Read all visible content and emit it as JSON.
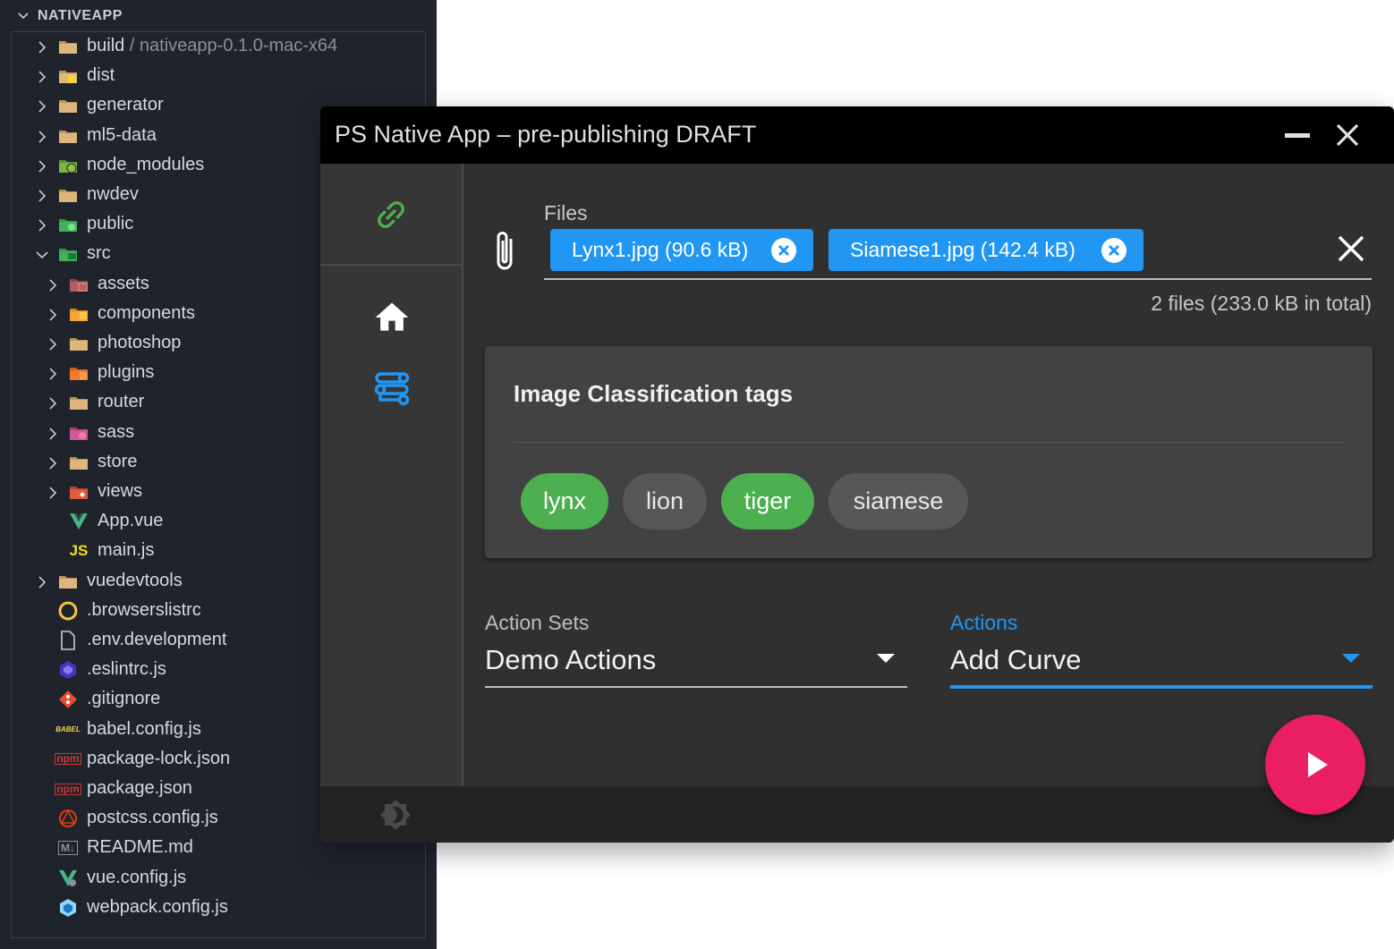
{
  "explorer": {
    "root_label": "NATIVEAPP",
    "items": [
      {
        "label": "build",
        "label_suffix": " / nativeapp-0.1.0-mac-x64",
        "icon": "folder-icon",
        "level": 0,
        "expandable": true,
        "expanded": false
      },
      {
        "label": "dist",
        "icon": "folder-dist-icon",
        "level": 0,
        "expandable": true,
        "expanded": false
      },
      {
        "label": "generator",
        "icon": "folder-icon",
        "level": 0,
        "expandable": true,
        "expanded": false
      },
      {
        "label": "ml5-data",
        "icon": "folder-icon",
        "level": 0,
        "expandable": true,
        "expanded": false
      },
      {
        "label": "node_modules",
        "icon": "folder-node-icon",
        "level": 0,
        "expandable": true,
        "expanded": false
      },
      {
        "label": "nwdev",
        "icon": "folder-icon",
        "level": 0,
        "expandable": true,
        "expanded": false
      },
      {
        "label": "public",
        "icon": "folder-public-icon",
        "level": 0,
        "expandable": true,
        "expanded": false
      },
      {
        "label": "src",
        "icon": "folder-src-icon",
        "level": 0,
        "expandable": true,
        "expanded": true
      },
      {
        "label": "assets",
        "icon": "folder-assets-icon",
        "level": 1,
        "expandable": true,
        "expanded": false
      },
      {
        "label": "components",
        "icon": "folder-components-icon",
        "level": 1,
        "expandable": true,
        "expanded": false
      },
      {
        "label": "photoshop",
        "icon": "folder-icon",
        "level": 1,
        "expandable": true,
        "expanded": false
      },
      {
        "label": "plugins",
        "icon": "folder-plugins-icon",
        "level": 1,
        "expandable": true,
        "expanded": false
      },
      {
        "label": "router",
        "icon": "folder-icon",
        "level": 1,
        "expandable": true,
        "expanded": false
      },
      {
        "label": "sass",
        "icon": "folder-sass-icon",
        "level": 1,
        "expandable": true,
        "expanded": false
      },
      {
        "label": "store",
        "icon": "folder-icon",
        "level": 1,
        "expandable": true,
        "expanded": false
      },
      {
        "label": "views",
        "icon": "folder-views-icon",
        "level": 1,
        "expandable": true,
        "expanded": false
      },
      {
        "label": "App.vue",
        "icon": "vue-file-icon",
        "level": 1,
        "expandable": false
      },
      {
        "label": "main.js",
        "icon": "js-file-icon",
        "icon_text": "JS",
        "level": 1,
        "expandable": false
      },
      {
        "label": "vuedevtools",
        "icon": "folder-icon",
        "level": 0,
        "expandable": true,
        "expanded": false
      },
      {
        "label": ".browserslistrc",
        "icon": "browserslist-icon",
        "level": 0,
        "expandable": false
      },
      {
        "label": ".env.development",
        "icon": "file-icon",
        "level": 0,
        "expandable": false
      },
      {
        "label": ".eslintrc.js",
        "icon": "eslint-icon",
        "level": 0,
        "expandable": false
      },
      {
        "label": ".gitignore",
        "icon": "git-icon",
        "level": 0,
        "expandable": false
      },
      {
        "label": "babel.config.js",
        "icon": "babel-icon",
        "icon_text": "BABEL",
        "level": 0,
        "expandable": false
      },
      {
        "label": "package-lock.json",
        "icon": "npm-icon",
        "icon_text": "npm",
        "level": 0,
        "expandable": false
      },
      {
        "label": "package.json",
        "icon": "npm-icon",
        "icon_text": "npm",
        "level": 0,
        "expandable": false
      },
      {
        "label": "postcss.config.js",
        "icon": "postcss-icon",
        "level": 0,
        "expandable": false
      },
      {
        "label": "README.md",
        "icon": "markdown-icon",
        "icon_text": "M↓",
        "level": 0,
        "expandable": false
      },
      {
        "label": "vue.config.js",
        "icon": "vue-config-icon",
        "level": 0,
        "expandable": false
      },
      {
        "label": "webpack.config.js",
        "icon": "webpack-icon",
        "level": 0,
        "expandable": false
      }
    ]
  },
  "app": {
    "title": "PS Native App – pre-publishing DRAFT",
    "files": {
      "label": "Files",
      "chips": [
        {
          "text": "Lynx1.jpg (90.6 kB)"
        },
        {
          "text": "Siamese1.jpg (142.4 kB)"
        }
      ],
      "summary": "2 files (233.0 kB in total)"
    },
    "tags_card": {
      "title": "Image Classification tags",
      "tags": [
        {
          "text": "lynx",
          "selected": true
        },
        {
          "text": "lion",
          "selected": false
        },
        {
          "text": "tiger",
          "selected": true
        },
        {
          "text": "siamese",
          "selected": false
        }
      ]
    },
    "action_sets": {
      "label": "Action Sets",
      "value": "Demo Actions",
      "focused": false
    },
    "actions": {
      "label": "Actions",
      "value": "Add Curve",
      "focused": true
    },
    "colors": {
      "primary": "#2196f3",
      "tag_selected": "#4caf50",
      "fab": "#e91e63",
      "nav_link_icon": "#4caf50"
    }
  }
}
